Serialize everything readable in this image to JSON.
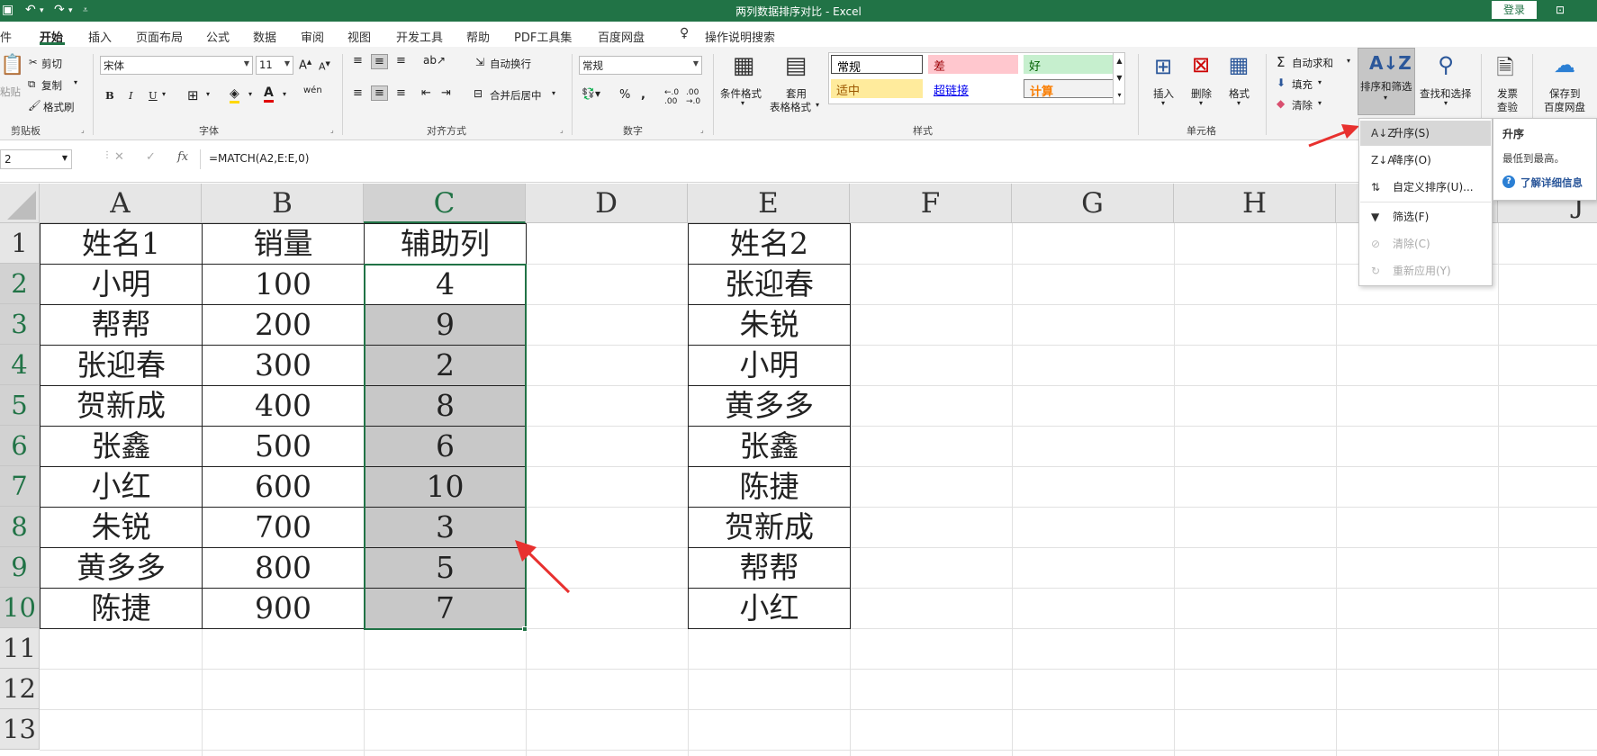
{
  "titlebar": {
    "title": "两列数据排序对比  -  Excel",
    "login": "登录"
  },
  "tabs": [
    "件",
    "开始",
    "插入",
    "页面布局",
    "公式",
    "数据",
    "审阅",
    "视图",
    "开发工具",
    "帮助",
    "PDF工具集",
    "百度网盘",
    "操作说明搜索"
  ],
  "ribbon": {
    "clipboard": {
      "cut": "剪切",
      "copy": "复制",
      "format_painter": "格式刷",
      "paste": "粘贴",
      "group": "剪贴板"
    },
    "font": {
      "name": "宋体",
      "size": "11",
      "bold": "B",
      "italic": "I",
      "underline": "U",
      "group": "字体"
    },
    "align": {
      "wrap": "自动换行",
      "merge": "合并后居中",
      "group": "对齐方式"
    },
    "number": {
      "format": "常规",
      "group": "数字"
    },
    "styles": {
      "cond_format": "条件格式",
      "table_format_1": "套用",
      "table_format_2": "表格格式",
      "normal": "常规",
      "bad": "差",
      "good": "好",
      "neutral": "适中",
      "hyperlink": "超链接",
      "calc": "计算",
      "group": "样式"
    },
    "cells": {
      "insert": "插入",
      "delete": "删除",
      "format": "格式",
      "group": "单元格"
    },
    "editing": {
      "autosum": "自动求和",
      "fill": "填充",
      "clear": "清除",
      "sort_filter": "排序和筛选",
      "find_select": "查找和选择"
    },
    "invoice": {
      "line1": "发票",
      "line2": "查验"
    },
    "baidu": {
      "line1": "保存到",
      "line2": "百度网盘"
    }
  },
  "formula_bar": {
    "name_box": "2",
    "formula": "=MATCH(A2,E:E,0)"
  },
  "columns": [
    "A",
    "B",
    "C",
    "D",
    "E",
    "F",
    "G",
    "H",
    "I",
    "J"
  ],
  "rows": [
    "1",
    "2",
    "3",
    "4",
    "5",
    "6",
    "7",
    "8",
    "9",
    "10",
    "11",
    "12",
    "13"
  ],
  "table1": {
    "headers": [
      "姓名1",
      "销量",
      "辅助列"
    ],
    "rows": [
      [
        "小明",
        "100",
        "4"
      ],
      [
        "帮帮",
        "200",
        "9"
      ],
      [
        "张迎春",
        "300",
        "2"
      ],
      [
        "贺新成",
        "400",
        "8"
      ],
      [
        "张鑫",
        "500",
        "6"
      ],
      [
        "小红",
        "600",
        "10"
      ],
      [
        "朱锐",
        "700",
        "3"
      ],
      [
        "黄多多",
        "800",
        "5"
      ],
      [
        "陈捷",
        "900",
        "7"
      ]
    ]
  },
  "table2": {
    "header": "姓名2",
    "rows": [
      "张迎春",
      "朱锐",
      "小明",
      "黄多多",
      "张鑫",
      "陈捷",
      "贺新成",
      "帮帮",
      "小红"
    ]
  },
  "sort_menu": {
    "items": [
      {
        "label": "升序(S)",
        "icon": "sort-ascending-icon"
      },
      {
        "label": "降序(O)",
        "icon": "sort-descending-icon"
      },
      {
        "label": "自定义排序(U)...",
        "icon": "custom-sort-icon"
      },
      {
        "label": "筛选(F)",
        "icon": "filter-icon"
      },
      {
        "label": "清除(C)",
        "icon": "clear-filter-icon"
      },
      {
        "label": "重新应用(Y)",
        "icon": "reapply-icon"
      }
    ]
  },
  "tooltip": {
    "title": "升序",
    "desc": "最低到最高。",
    "link": "了解详细信息"
  },
  "colors": {
    "excel_green": "#217346",
    "selection_fill": "#c8c8c8",
    "arrow_red": "#e8312f"
  }
}
